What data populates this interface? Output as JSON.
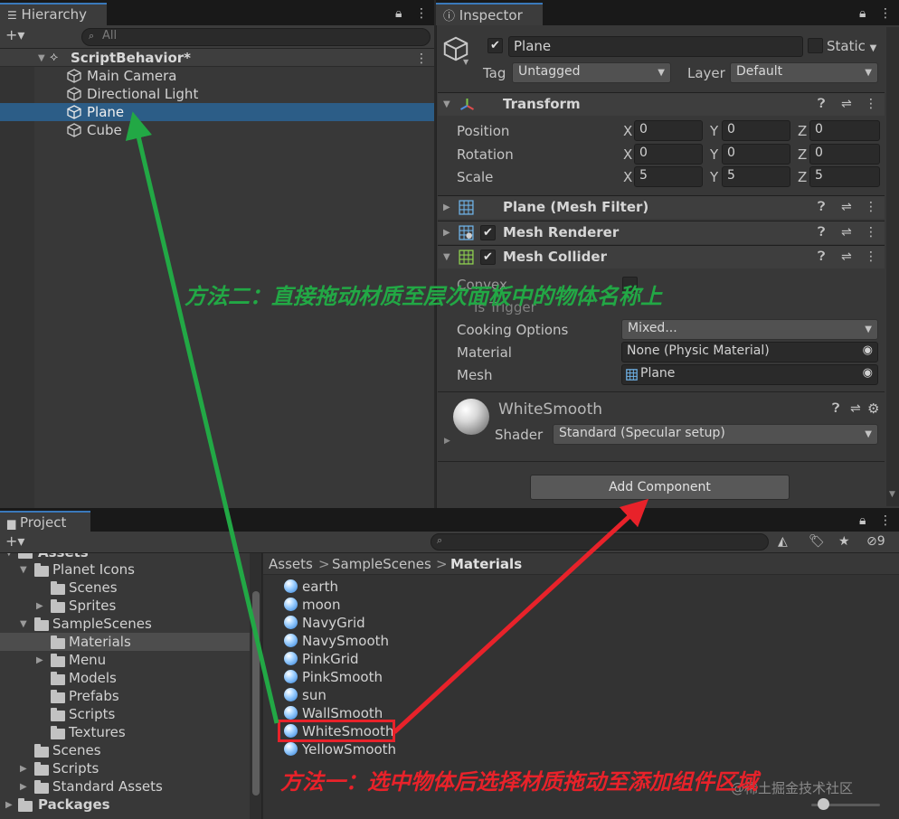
{
  "hierarchy": {
    "tab_label": "Hierarchy",
    "add_label": "+▾",
    "search_placeholder": "All",
    "scene_name": "ScriptBehavior*",
    "items": [
      {
        "label": "Main Camera"
      },
      {
        "label": "Directional Light"
      },
      {
        "label": "Plane",
        "selected": true
      },
      {
        "label": "Cube"
      }
    ]
  },
  "inspector": {
    "tab_label": "Inspector",
    "object_name": "Plane",
    "static_label": "Static",
    "tag_label": "Tag",
    "tag_value": "Untagged",
    "layer_label": "Layer",
    "layer_value": "Default",
    "transform": {
      "title": "Transform",
      "rows": [
        {
          "label": "Position",
          "x": "0",
          "y": "0",
          "z": "0"
        },
        {
          "label": "Rotation",
          "x": "0",
          "y": "0",
          "z": "0"
        },
        {
          "label": "Scale",
          "x": "5",
          "y": "5",
          "z": "5"
        }
      ],
      "axis_x": "X",
      "axis_y": "Y",
      "axis_z": "Z"
    },
    "mesh_filter_title": "Plane (Mesh Filter)",
    "mesh_renderer_title": "Mesh Renderer",
    "mesh_collider": {
      "title": "Mesh Collider",
      "convex_label": "Convex",
      "is_trigger_label": "Is Trigger",
      "cooking_label": "Cooking Options",
      "cooking_value": "Mixed...",
      "material_label": "Material",
      "material_value": "None (Physic Material)",
      "mesh_label": "Mesh",
      "mesh_value": "Plane"
    },
    "material": {
      "name": "WhiteSmooth",
      "shader_label": "Shader",
      "shader_value": "Standard (Specular setup)"
    },
    "add_component_label": "Add Component"
  },
  "project": {
    "tab_label": "Project",
    "add_label": "+▾",
    "hidden_count": "9",
    "tree": [
      {
        "label": "Assets",
        "depth": 1
      },
      {
        "label": "Planet Icons",
        "depth": 2,
        "expanded": true
      },
      {
        "label": "Scenes",
        "depth": 3
      },
      {
        "label": "Sprites",
        "depth": 3,
        "collapsed": true
      },
      {
        "label": "SampleScenes",
        "depth": 2,
        "expanded": true
      },
      {
        "label": "Materials",
        "depth": 3,
        "selected": true
      },
      {
        "label": "Menu",
        "depth": 3,
        "collapsed": true
      },
      {
        "label": "Models",
        "depth": 3
      },
      {
        "label": "Prefabs",
        "depth": 3
      },
      {
        "label": "Scripts",
        "depth": 3
      },
      {
        "label": "Textures",
        "depth": 3
      },
      {
        "label": "Scenes",
        "depth": 2
      },
      {
        "label": "Scripts",
        "depth": 2,
        "collapsed": true
      },
      {
        "label": "Standard Assets",
        "depth": 2,
        "collapsed": true
      },
      {
        "label": "Packages",
        "depth": 1,
        "collapsed": true
      }
    ],
    "breadcrumb": [
      "Assets",
      "SampleScenes",
      "Materials"
    ],
    "breadcrumb_sep": ">",
    "assets": [
      {
        "label": "earth"
      },
      {
        "label": "moon"
      },
      {
        "label": "NavyGrid"
      },
      {
        "label": "NavySmooth"
      },
      {
        "label": "PinkGrid"
      },
      {
        "label": "PinkSmooth"
      },
      {
        "label": "sun"
      },
      {
        "label": "WallSmooth"
      },
      {
        "label": "WhiteSmooth",
        "highlighted": true
      },
      {
        "label": "YellowSmooth"
      }
    ]
  },
  "annotations": {
    "method_two": "方法二：直接拖动材质至层次面板中的物体名称上",
    "method_one": "方法一：选中物体后选择材质拖动至添加组件区域",
    "green": "#22a845",
    "red": "#e8222a"
  },
  "watermark": "@稀土掘金技术社区",
  "colors": {
    "selection": "#2c5d87",
    "accent_tab": "#3a79bb"
  }
}
